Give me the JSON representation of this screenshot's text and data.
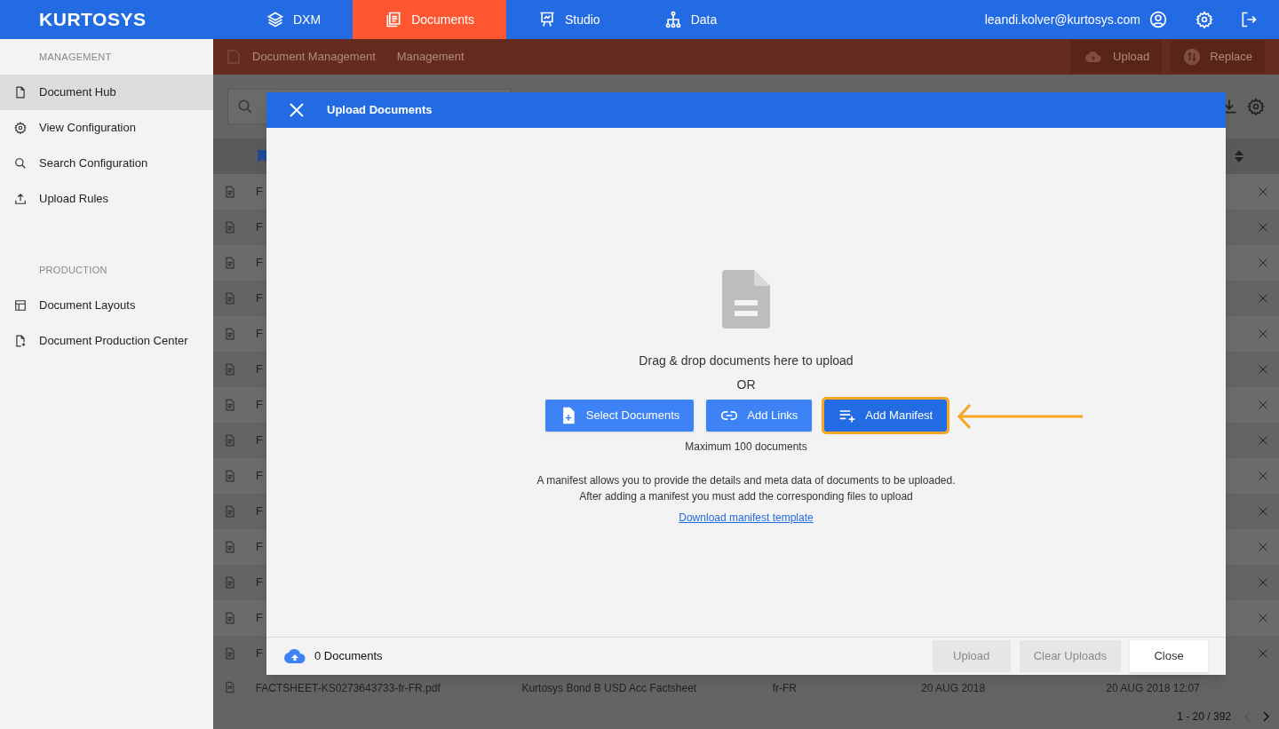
{
  "topbar": {
    "logo": "KURTOSYS",
    "nav": [
      {
        "label": "DXM",
        "selected": false
      },
      {
        "label": "Documents",
        "selected": true
      },
      {
        "label": "Studio",
        "selected": false
      },
      {
        "label": "Data",
        "selected": false
      }
    ],
    "user": "leandi.kolver@kurtosys.com"
  },
  "sidebar": {
    "sections": [
      {
        "heading": "MANAGEMENT",
        "items": [
          {
            "label": "Document Hub",
            "selected": true
          },
          {
            "label": "View Configuration",
            "selected": false
          },
          {
            "label": "Search Configuration",
            "selected": false
          },
          {
            "label": "Upload Rules",
            "selected": false
          }
        ]
      },
      {
        "heading": "PRODUCTION",
        "items": [
          {
            "label": "Document Layouts",
            "selected": false
          },
          {
            "label": "Document Production Center",
            "selected": false
          }
        ]
      }
    ]
  },
  "subheader": {
    "breadcrumbs": [
      "Document Management",
      "Management"
    ],
    "actions": [
      "Upload",
      "Replace"
    ]
  },
  "table": {
    "rows": [
      {
        "name": "F"
      },
      {
        "name": "F"
      },
      {
        "name": "F"
      },
      {
        "name": "F"
      },
      {
        "name": "F"
      },
      {
        "name": "F"
      },
      {
        "name": "F"
      },
      {
        "name": "F"
      },
      {
        "name": "F"
      },
      {
        "name": "F"
      },
      {
        "name": "F"
      },
      {
        "name": "F"
      },
      {
        "name": "F"
      },
      {
        "name": "F"
      }
    ],
    "last_row": [
      "FACTSHEET-KS0273643733-fr-FR.pdf",
      "Kurtosys Bond B USD Acc Factsheet",
      "fr-FR",
      "20 AUG 2018",
      "20 AUG 2018 12:07"
    ],
    "pagination": "1 - 20 / 392"
  },
  "modal": {
    "title": "Upload Documents",
    "prompt": "Drag & drop documents here to upload",
    "or": "OR",
    "buttons": [
      {
        "label": "Select Documents",
        "highlighted": false
      },
      {
        "label": "Add Links",
        "highlighted": false
      },
      {
        "label": "Add Manifest",
        "highlighted": true
      }
    ],
    "limit": "Maximum 100 documents",
    "description": [
      "A manifest allows you to provide the details and meta data of documents to be uploaded.",
      "After adding a manifest you must add the corresponding files to upload"
    ],
    "link": "Download manifest template",
    "count": "0 Documents",
    "footer_buttons": [
      {
        "label": "Upload",
        "disabled": true
      },
      {
        "label": "Clear Uploads",
        "disabled": true
      },
      {
        "label": "Close",
        "disabled": false
      }
    ]
  }
}
